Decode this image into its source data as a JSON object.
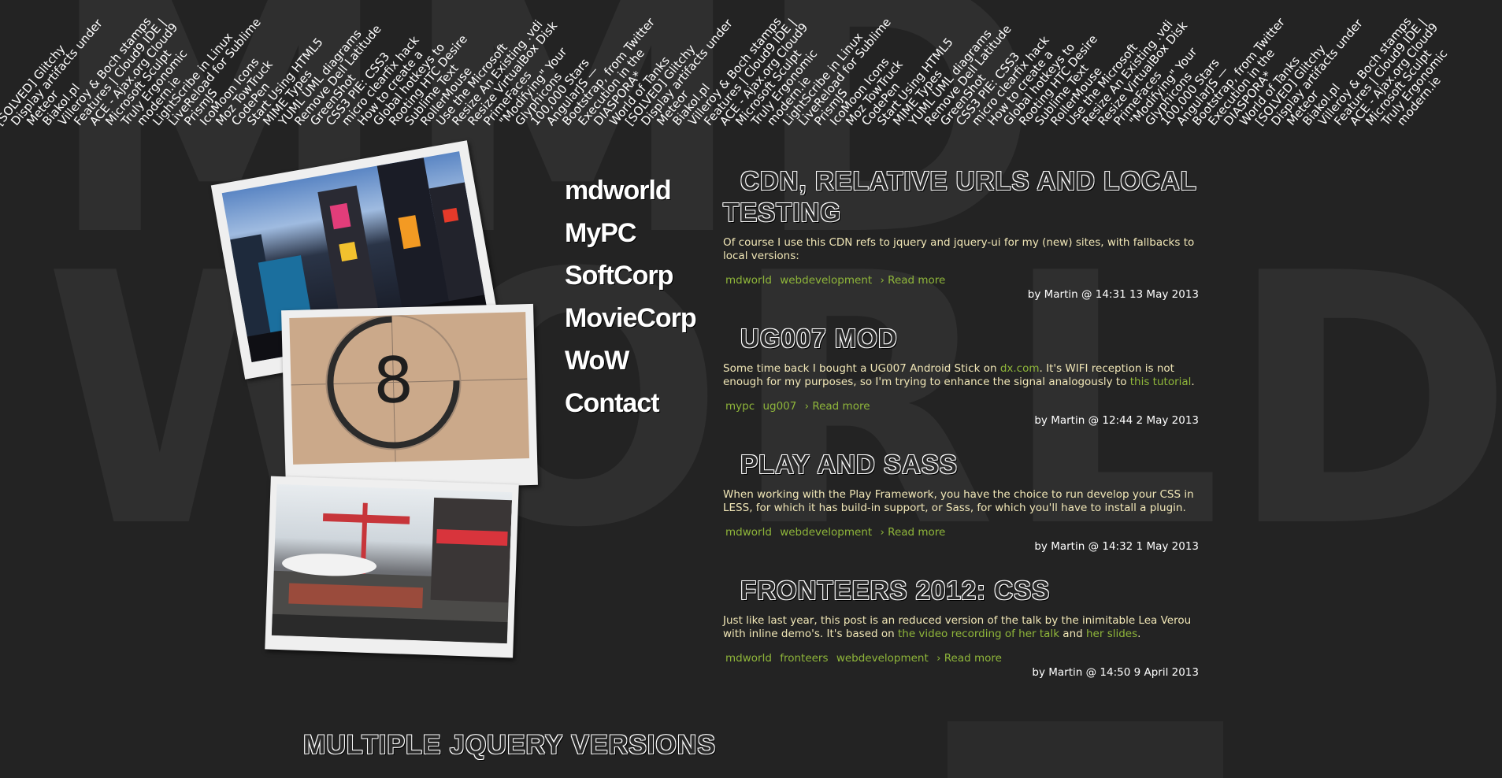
{
  "background": {
    "line1": "MMD",
    "line2": "WORLD"
  },
  "tags": [
    "[SOLVED] Glitchy",
    "Display artifacts under",
    "Meteor",
    "Biakol.pl",
    "Villeroy & Boch stamps",
    "Features | Cloud9 IDE |",
    "ACE - Ajax.org Cloud9",
    "Microsoft Sculpt",
    "Truly Ergonomic",
    "modern.ie",
    "LightScribe in Linux",
    "LiveReload for Sublime",
    "PrismJS",
    "IcoMoon Icons",
    "Moz TowTruck",
    "CodePen",
    "Start Using HTML5",
    "MIME Types",
    "YUML UML diagrams",
    "Remove Dell Latitude",
    "GreenShot",
    "CSS3 PIE: CSS3",
    "micro clearfix hack",
    "How to create a",
    "Global hotkeys to",
    "Rooting HTC Desire",
    "Sublime Text",
    "RollerMouse",
    "Use the Microsoft",
    "Resize An Existing .vdi",
    "Resize VirtualBox Disk",
    "PrimeFaces",
    "\"Modifying\" Your",
    "Glyphicons",
    "100,000 Stars",
    "AngularJS —",
    "Bootstrap, from Twitter",
    "Execution in the",
    "DIASPORA*",
    "World of Tanks",
    "[SOLVED] Glitchy",
    "Display artifacts under",
    "Meteor",
    "Biakol.pl",
    "Villeroy & Boch stamps",
    "Features | Cloud9 IDE |",
    "ACE - Ajax.org Cloud9",
    "Microsoft Sculpt",
    "Truly Ergonomic",
    "modern.ie",
    "LightScribe in Linux",
    "LiveReload for Sublime",
    "PrismJS",
    "IcoMoon Icons",
    "Moz TowTruck",
    "CodePen",
    "Start Using HTML5",
    "MIME Types",
    "YUML UML diagrams",
    "Remove Dell Latitude",
    "GreenShot",
    "CSS3 PIE: CSS3",
    "micro clearfix hack",
    "How to create a",
    "Global hotkeys to",
    "Rooting HTC Desire",
    "Sublime Text",
    "RollerMouse",
    "Use the Microsoft",
    "Resize An Existing .vdi",
    "Resize VirtualBox Disk",
    "PrimeFaces",
    "\"Modifying\" Your",
    "Glyphicons",
    "100,000 Stars",
    "AngularJS —",
    "Bootstrap, from Twitter",
    "Execution in the",
    "DIASPORA*",
    "World of Tanks",
    "[SOLVED] Glitchy",
    "Display artifacts under",
    "Meteor",
    "Biakol.pl",
    "Villeroy & Boch stamps",
    "Features | Cloud9 IDE |",
    "ACE - Ajax.org Cloud9",
    "Microsoft Sculpt",
    "Truly Ergonomic",
    "modern.ie"
  ],
  "nav": [
    "mdworld",
    "MyPC",
    "SoftCorp",
    "MovieCorp",
    "WoW",
    "Contact"
  ],
  "posts": [
    {
      "title": "CDN, relative urls and local testing",
      "body": "Of course I use this CDN refs to jquery and jquery-ui for my (new) sites, with fallbacks to local versions:",
      "tags": [
        "mdworld",
        "webdevelopment"
      ],
      "read_more": "› Read more",
      "byline": "by Martin @ 14:31 13 May 2013"
    },
    {
      "title": "UG007 mod",
      "body_pre": "Some time back I bought a UG007 Android Stick on ",
      "link1": "dx.com",
      "body_mid": ". It's WIFI reception is not enough for my purposes, so I'm trying to enhance the signal analogously to ",
      "link2": "this tutorial",
      "body_post": ".",
      "tags": [
        "mypc",
        "ug007"
      ],
      "read_more": "› Read more",
      "byline": "by Martin @ 12:44 2 May 2013"
    },
    {
      "title": "Play and SASS",
      "body": "When working with the Play Framework, you have the choice to run develop your CSS in LESS, for which it has build-in support, or Sass, for which you'll have to install a plugin.",
      "tags": [
        "mdworld",
        "webdevelopment"
      ],
      "read_more": "› Read more",
      "byline": "by Martin @ 14:32 1 May 2013"
    },
    {
      "title": "Fronteers 2012: CSS",
      "body_pre": "Just like last year, this post is an reduced version of the talk by the inimitable Lea Verou with inline demo's. It's based on ",
      "link1": "the video recording of her talk",
      "body_mid": " and ",
      "link2": "her slides",
      "body_post": ".",
      "tags": [
        "mdworld",
        "fronteers",
        "webdevelopment"
      ],
      "read_more": "› Read more",
      "byline": "by Martin @ 14:50 9 April 2013"
    }
  ],
  "bottom_title": "Multiple jQuery versions",
  "colors": {
    "background": "#232323",
    "link": "#8fb63a",
    "body_text": "#f0e6b6"
  }
}
